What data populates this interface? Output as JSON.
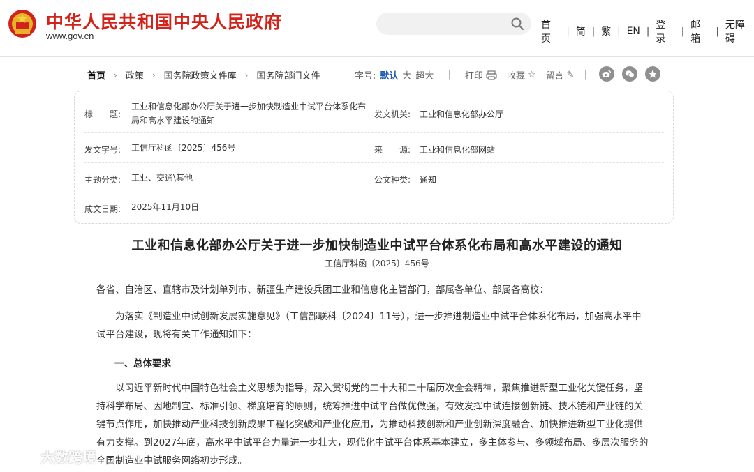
{
  "header": {
    "site_title": "中华人民共和国中央人民政府",
    "site_domain": "www.gov.cn",
    "search_placeholder": "",
    "nav": [
      "首页",
      "简",
      "繁",
      "EN",
      "登录",
      "邮箱",
      "无障碍"
    ]
  },
  "breadcrumb": [
    "首页",
    "政策",
    "国务院政策文件库",
    "国务院部门文件"
  ],
  "tools": {
    "font_label": "字号:",
    "sizes": [
      "默认",
      "大",
      "超大"
    ],
    "active_size": "默认",
    "print": "打印",
    "favorite": "收藏",
    "comment": "留言"
  },
  "social_icons": [
    "weibo-icon",
    "wechat-icon",
    "star-icon"
  ],
  "info": {
    "title_key": "标　　题:",
    "title_val_line1": "工业和信息化部办公厅关于进一步加快制造业中试平台体系化布",
    "title_val_line2": "局和高水平建设的通知",
    "issuer_key": "发文机关:",
    "issuer_val": "工业和信息化部办公厅",
    "docno_key": "发文字号:",
    "docno_val": "工信厅科函〔2025〕456号",
    "source_key": "来　　源:",
    "source_val": "工业和信息化部网站",
    "topic_key": "主题分类:",
    "topic_val": "工业、交通\\其他",
    "type_key": "公文种类:",
    "type_val": "通知",
    "date_key": "成文日期:",
    "date_val": "2025年11月10日"
  },
  "doc": {
    "title": "工业和信息化部办公厅关于进一步加快制造业中试平台体系化布局和高水平建设的通知",
    "number": "工信厅科函〔2025〕456号",
    "salutation": "各省、自治区、直辖市及计划单列市、新疆生产建设兵团工业和信息化主管部门，部属各单位、部属各高校：",
    "intro_line1": "　　为落实《制造业中试创新发展实施意见》（工信部联科〔2024〕11号），进一步推进制造业中试平台体系化布局，加强高水平中",
    "intro_line2": "试平台建设，现将有关工作通知如下：",
    "section1": "一、总体要求",
    "p1_line1": "　　以习近平新时代中国特色社会主义思想为指导，深入贯彻党的二十大和二十届历次全会精神，聚焦推进新型工业化关键任务，坚",
    "p1_line2": "持科学布局、因地制宜、标准引领、梯度培育的原则，统筹推进中试平台做优做强，有效发挥中试连接创新链、技术链和产业链的关",
    "p1_line3": "键节点作用，加快推动产业科技创新成果工程化突破和产业化应用，为推动科技创新和产业创新深度融合、加快推进新型工业化提供",
    "p1_line4": "有力支撑。到2027年底，高水平中试平台力量进一步壮大，现代化中试平台体系基本建立，多主体参与、多领域布局、多层次服务的",
    "p1_line5": "全国制造业中试服务网络初步形成。"
  },
  "watermark": "大数跨境",
  "colors": {
    "brand_red": "#d2231b",
    "active_blue": "#1f5bb0",
    "icon_gray": "#8f8f8f"
  }
}
